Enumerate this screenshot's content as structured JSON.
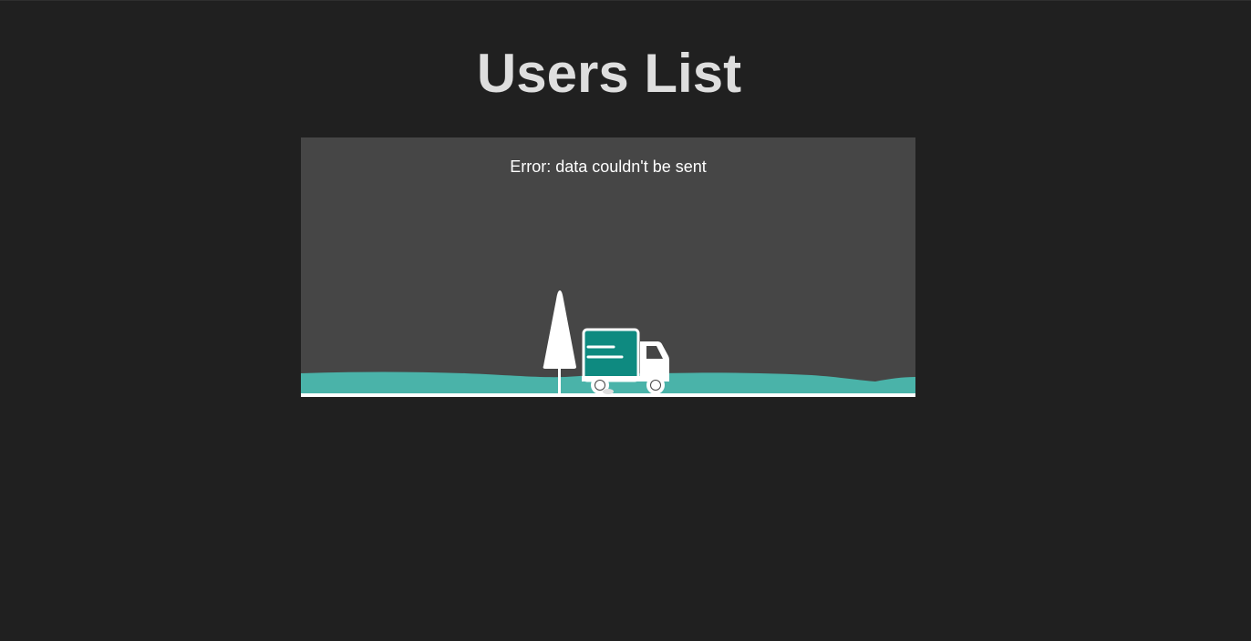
{
  "page": {
    "title": "Users List"
  },
  "status": {
    "error_message": "Error: data couldn't be sent"
  },
  "illustration": {
    "icons": [
      "tree-icon",
      "delivery-truck-icon"
    ],
    "colors": {
      "panel": "#464646",
      "ground": "#4ab3a9",
      "truck_box": "#0e8a80",
      "outline": "#ffffff"
    }
  },
  "colors": {
    "background": "#202020",
    "title": "#dedede",
    "message": "#ffffff"
  }
}
